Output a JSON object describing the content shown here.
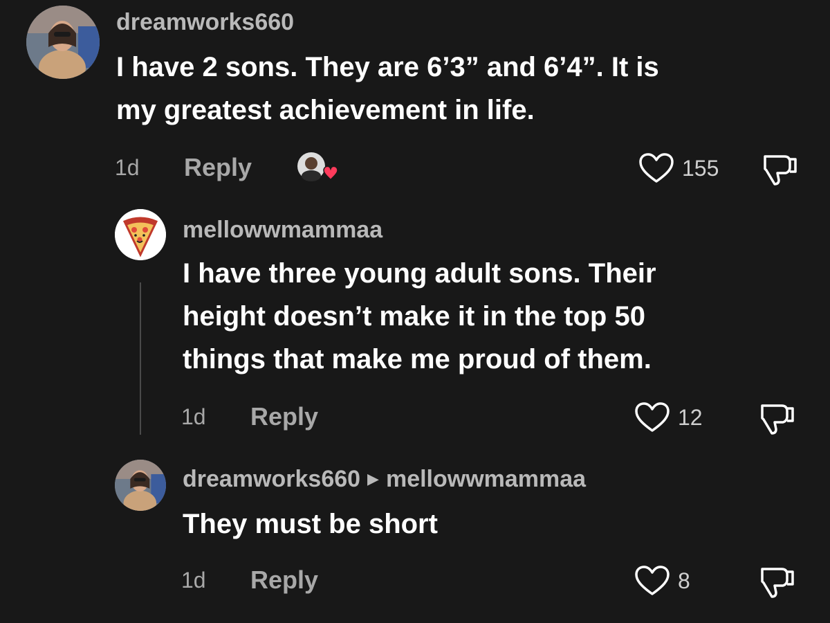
{
  "comments": [
    {
      "username": "dreamworks660",
      "text_line1": "I have 2 sons. They are 6’3” and 6’4”. It is",
      "text_line2": "my greatest achievement in life.",
      "time": "1d",
      "reply_label": "Reply",
      "likes": "155",
      "creator_liked": true
    },
    {
      "username": "mellowwmammaa",
      "text_line1": "I have three young adult sons. Their",
      "text_line2": "height doesn’t make it in the top 50",
      "text_line3": "things that make me proud of them.",
      "time": "1d",
      "reply_label": "Reply",
      "likes": "12"
    },
    {
      "username": "dreamworks660",
      "reply_to": "mellowwmammaa",
      "text_line1": "They must be short",
      "time": "1d",
      "reply_label": "Reply",
      "likes": "8"
    }
  ],
  "icons": {
    "like": "heart-outline-icon",
    "dislike": "thumbs-down-icon",
    "reply_arrow": "triangle-right-icon",
    "creator_like_badge": "red-heart-icon"
  },
  "colors": {
    "background": "#181818",
    "text": "#ffffff",
    "muted": "#a8a8a8",
    "heart_red": "#ff3b5c"
  }
}
